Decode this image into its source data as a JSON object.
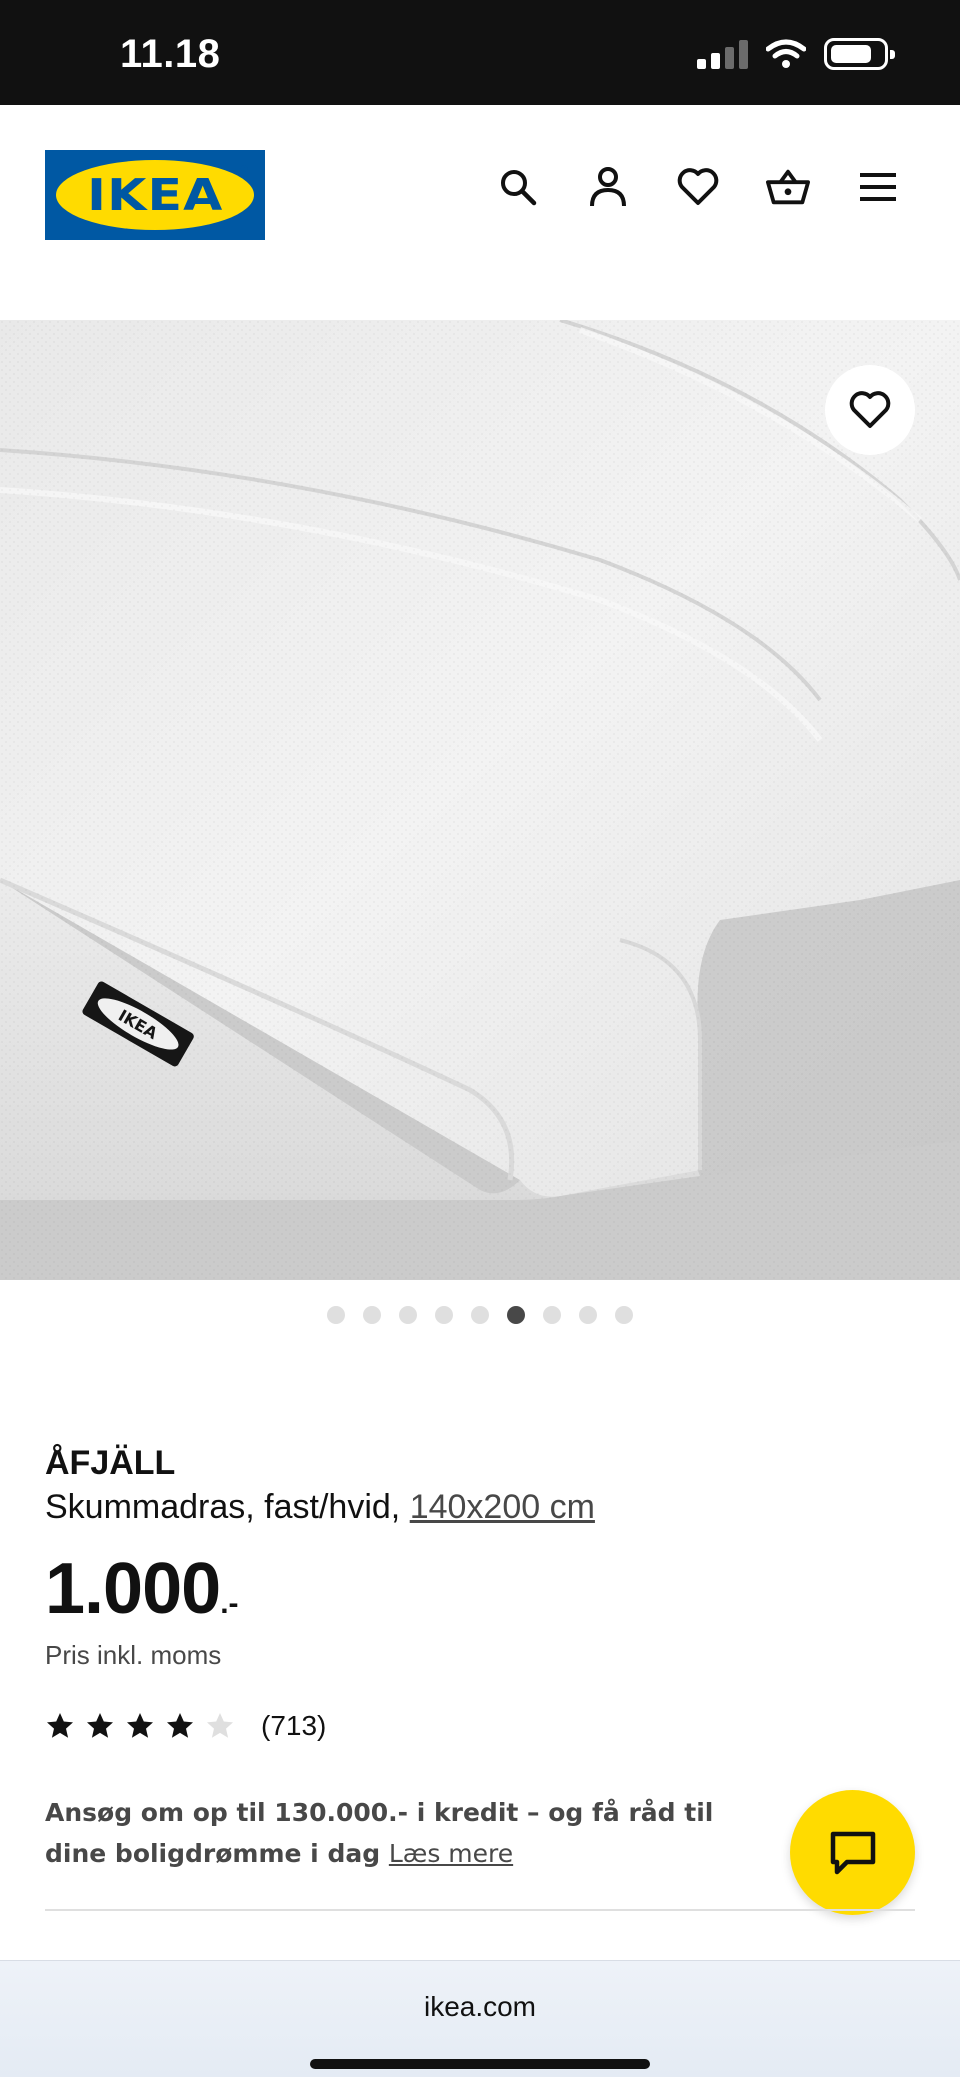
{
  "status_bar": {
    "time": "11.18"
  },
  "header": {
    "logo_text": "IKEA",
    "icons": [
      "search-icon",
      "user-icon",
      "heart-icon",
      "basket-icon",
      "menu-icon"
    ]
  },
  "gallery": {
    "image_count": 9,
    "active_index": 6
  },
  "product": {
    "name": "ÅFJÄLL",
    "description": "Skummadras, fast/hvid,",
    "size": "140x200 cm",
    "price": "1.000",
    "price_suffix": ".-",
    "price_note": "Pris inkl. moms",
    "rating_value": 4,
    "rating_max": 5,
    "rating_count": "(713)"
  },
  "credit": {
    "text": "Ansøg om op til 130.000.- i kredit – og få råd til dine boligdrømme i dag",
    "link_label": "Læs mere"
  },
  "browser": {
    "url": "ikea.com"
  },
  "colors": {
    "ikea_blue": "#0058a3",
    "ikea_yellow": "#ffdb00",
    "dark": "#111111",
    "grey_text": "#484848"
  }
}
